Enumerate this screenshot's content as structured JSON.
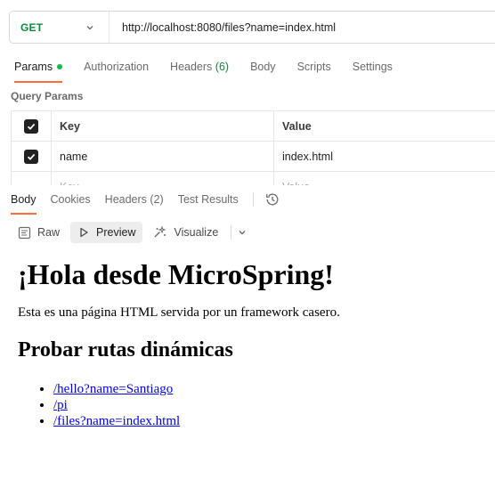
{
  "request": {
    "method": "GET",
    "url": "http://localhost:8080/files?name=index.html"
  },
  "request_tabs": [
    {
      "label": "Params",
      "active": true,
      "dot": true
    },
    {
      "label": "Authorization"
    },
    {
      "label": "Headers",
      "count": "(6)"
    },
    {
      "label": "Body"
    },
    {
      "label": "Scripts"
    },
    {
      "label": "Settings"
    }
  ],
  "query_params": {
    "title": "Query Params",
    "columns": {
      "key": "Key",
      "value": "Value"
    },
    "rows": [
      {
        "key": "name",
        "value": "index.html",
        "checked": true
      }
    ],
    "placeholder": {
      "key": "Key",
      "value": "Value"
    }
  },
  "response_tabs": [
    {
      "label": "Body",
      "active": true
    },
    {
      "label": "Cookies"
    },
    {
      "label": "Headers",
      "count": "(2)"
    },
    {
      "label": "Test Results"
    }
  ],
  "view_options": {
    "raw": "Raw",
    "preview": "Preview",
    "visualize": "Visualize"
  },
  "preview": {
    "heading": "¡Hola desde MicroSpring!",
    "paragraph": "Esta es una página HTML servida por un framework casero.",
    "subheading": "Probar rutas dinámicas",
    "links": [
      "/hello?name=Santiago",
      "/pi",
      "/files?name=index.html"
    ]
  },
  "colors": {
    "accent": "#ff6c37",
    "method_get": "#0b8a3a",
    "active_dot": "#0cbb52",
    "link": "#0000ee"
  }
}
